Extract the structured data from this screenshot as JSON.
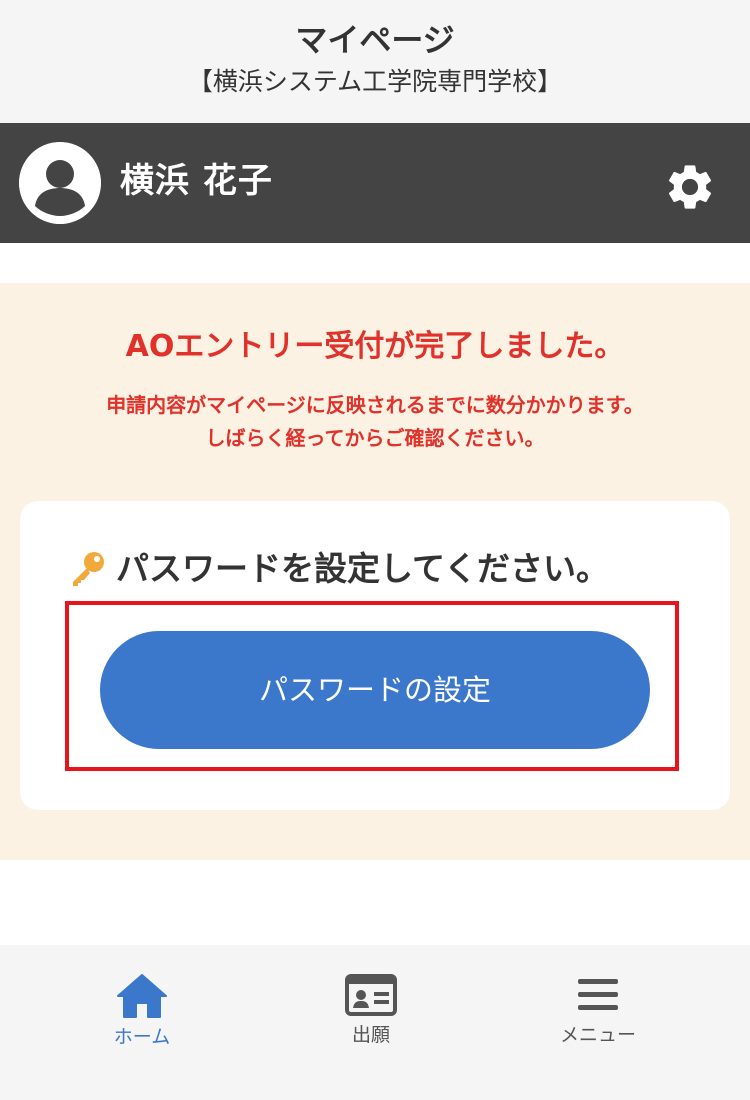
{
  "header": {
    "title": "マイページ",
    "subtitle": "【横浜システム工学院専門学校】"
  },
  "user": {
    "name": "横浜 花子",
    "avatar_icon": "user-avatar-icon",
    "settings_icon": "gear-icon"
  },
  "notice": {
    "title": "AOエントリー受付が完了しました。",
    "line1": "申請内容がマイページに反映されるまでに数分かかります。",
    "line2": "しばらく経ってからご確認ください。"
  },
  "password_card": {
    "icon": "key-icon",
    "heading": "パスワードを設定してください。",
    "button_label": "パスワードの設定"
  },
  "bottom_nav": {
    "items": [
      {
        "label": "ホーム",
        "icon": "home-icon",
        "active": true
      },
      {
        "label": "出願",
        "icon": "id-card-icon",
        "active": false
      },
      {
        "label": "メニュー",
        "icon": "hamburger-menu-icon",
        "active": false
      }
    ]
  },
  "colors": {
    "active": "#3b78cc",
    "inactive": "#555555",
    "alert": "#e0322b",
    "highlight": "#e8141b",
    "user_bar": "#444444",
    "notice_bg": "#fbf2e3"
  }
}
